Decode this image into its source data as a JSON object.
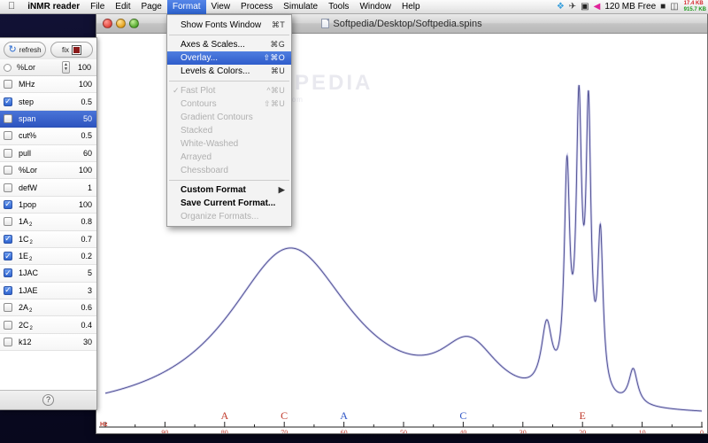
{
  "menubar": {
    "apple_icon": "apple-logo",
    "app_name": "iNMR reader",
    "items": [
      {
        "label": "File"
      },
      {
        "label": "Edit"
      },
      {
        "label": "Page"
      },
      {
        "label": "Format",
        "active": true
      },
      {
        "label": "View"
      },
      {
        "label": "Process"
      },
      {
        "label": "Simulate"
      },
      {
        "label": "Tools"
      },
      {
        "label": "Window"
      },
      {
        "label": "Help"
      }
    ],
    "status": {
      "memory_free": "120 MB Free",
      "net_up": "17.4 KB",
      "net_down": "915.7 KB",
      "icons": [
        "dropbox-icon",
        "bird-icon",
        "display-icon",
        "eject-icon",
        "battery-icon",
        "drive-icon"
      ]
    }
  },
  "window": {
    "title": "Softpedia/Desktop/Softpedia.spins",
    "doc_icon": "document-icon",
    "traffic_lights": [
      "close-button",
      "minimize-button",
      "zoom-button"
    ]
  },
  "menu": {
    "title": "Format",
    "groups": [
      [
        {
          "label": "Show Fonts Window",
          "shortcut": "⌘T",
          "enabled": true,
          "checked": false
        }
      ],
      [
        {
          "label": "Axes & Scales...",
          "shortcut": "⌘G",
          "enabled": true,
          "checked": false
        },
        {
          "label": "Overlay...",
          "shortcut": "⇧⌘O",
          "enabled": true,
          "checked": false,
          "highlighted": true
        },
        {
          "label": "Levels & Colors...",
          "shortcut": "⌘U",
          "enabled": true,
          "checked": false
        }
      ],
      [
        {
          "label": "Fast Plot",
          "shortcut": "^⌘U",
          "enabled": false,
          "checked": true
        },
        {
          "label": "Contours",
          "shortcut": "⇧⌘U",
          "enabled": false,
          "checked": false
        },
        {
          "label": "Gradient Contours",
          "shortcut": "",
          "enabled": false,
          "checked": false
        },
        {
          "label": "Stacked",
          "shortcut": "",
          "enabled": false,
          "checked": false
        },
        {
          "label": "White-Washed",
          "shortcut": "",
          "enabled": false,
          "checked": false
        },
        {
          "label": "Arrayed",
          "shortcut": "",
          "enabled": false,
          "checked": false
        },
        {
          "label": "Chessboard",
          "shortcut": "",
          "enabled": false,
          "checked": false
        }
      ],
      [
        {
          "label": "Custom Format",
          "shortcut": "▶",
          "enabled": true,
          "checked": false,
          "bold": true,
          "submenu": true
        },
        {
          "label": "Save Current Format...",
          "shortcut": "",
          "enabled": true,
          "checked": false,
          "bold": true
        },
        {
          "label": "Organize Formats...",
          "shortcut": "",
          "enabled": false,
          "checked": false
        }
      ]
    ]
  },
  "panel": {
    "refresh_label": "refresh",
    "refresh_icon": "refresh-icon",
    "fix_label": "fix",
    "fix_swatch_color": "#8b1a1a",
    "spin_row": {
      "name": "%Lor",
      "value": "100",
      "stepper_icon": "stepper-icon",
      "radio_icon": "radio-button"
    },
    "help_label": "?",
    "rows": [
      {
        "name": "MHz",
        "sub": "",
        "value": "100",
        "checked": false,
        "selected": false
      },
      {
        "name": "step",
        "sub": "",
        "value": "0.5",
        "checked": true,
        "selected": false
      },
      {
        "name": "span",
        "sub": "",
        "value": "50",
        "checked": false,
        "selected": true
      },
      {
        "name": "cut%",
        "sub": "",
        "value": "0.5",
        "checked": false,
        "selected": false
      },
      {
        "name": "pull",
        "sub": "",
        "value": "60",
        "checked": false,
        "selected": false
      },
      {
        "name": "%Lor",
        "sub": "",
        "value": "100",
        "checked": false,
        "selected": false
      },
      {
        "name": "defW",
        "sub": "",
        "value": "1",
        "checked": false,
        "selected": false
      },
      {
        "name": "1pop",
        "sub": "",
        "value": "100",
        "checked": true,
        "selected": false
      },
      {
        "name": "1A",
        "sub": "2",
        "value": "0.8",
        "checked": false,
        "selected": false
      },
      {
        "name": "1C",
        "sub": "2",
        "value": "0.7",
        "checked": true,
        "selected": false
      },
      {
        "name": "1E",
        "sub": "2",
        "value": "0.2",
        "checked": true,
        "selected": false
      },
      {
        "name": "1JAC",
        "sub": "",
        "value": "5",
        "checked": true,
        "selected": false
      },
      {
        "name": "1JAE",
        "sub": "",
        "value": "3",
        "checked": true,
        "selected": false
      },
      {
        "name": "2A",
        "sub": "2",
        "value": "0.6",
        "checked": false,
        "selected": false
      },
      {
        "name": "2C",
        "sub": "2",
        "value": "0.4",
        "checked": false,
        "selected": false
      },
      {
        "name": "k12",
        "sub": "",
        "value": "30",
        "checked": false,
        "selected": false
      }
    ]
  },
  "chart_data": {
    "type": "line",
    "title": "",
    "xlabel": "Hz",
    "ylabel": "",
    "axis_unit_label": "Hz",
    "xlim": [
      100,
      0
    ],
    "grid": false,
    "trace_color": "#4b4b8f",
    "tick_labels": [
      "90",
      "80",
      "70",
      "60",
      "50",
      "40",
      "30",
      "20",
      "10",
      "0"
    ],
    "tick_values": [
      90,
      80,
      70,
      60,
      50,
      40,
      30,
      20,
      10,
      0
    ],
    "minor_ticks": [
      95,
      85,
      75,
      65,
      55,
      45,
      35,
      25,
      15,
      5
    ],
    "peak_markers": [
      {
        "label": "A",
        "hz": 80,
        "color": "#c0392b"
      },
      {
        "label": "C",
        "hz": 70,
        "color": "#c0392b"
      },
      {
        "label": "A",
        "hz": 60,
        "color": "#2b52c4"
      },
      {
        "label": "C",
        "hz": 40,
        "color": "#2b52c4"
      },
      {
        "label": "E",
        "hz": 20,
        "color": "#c0392b"
      }
    ],
    "peaks": [
      {
        "hz": 69.0,
        "height": 0.62,
        "width": 13.0,
        "kind": "broad"
      },
      {
        "hz": 39.0,
        "height": 0.2,
        "width": 6.0,
        "kind": "broad"
      },
      {
        "hz": 26.0,
        "height": 0.24,
        "width": 1.1,
        "kind": "sharp"
      },
      {
        "hz": 22.6,
        "height": 0.78,
        "width": 0.55,
        "kind": "sharp"
      },
      {
        "hz": 20.6,
        "height": 1.0,
        "width": 0.55,
        "kind": "sharp"
      },
      {
        "hz": 19.0,
        "height": 0.98,
        "width": 0.5,
        "kind": "sharp"
      },
      {
        "hz": 17.0,
        "height": 0.57,
        "width": 0.55,
        "kind": "sharp"
      },
      {
        "hz": 11.5,
        "height": 0.13,
        "width": 0.9,
        "kind": "sharp"
      }
    ]
  },
  "watermark": {
    "line1": "SOFTPEDIA",
    "line2": "www.softpedia.com"
  }
}
